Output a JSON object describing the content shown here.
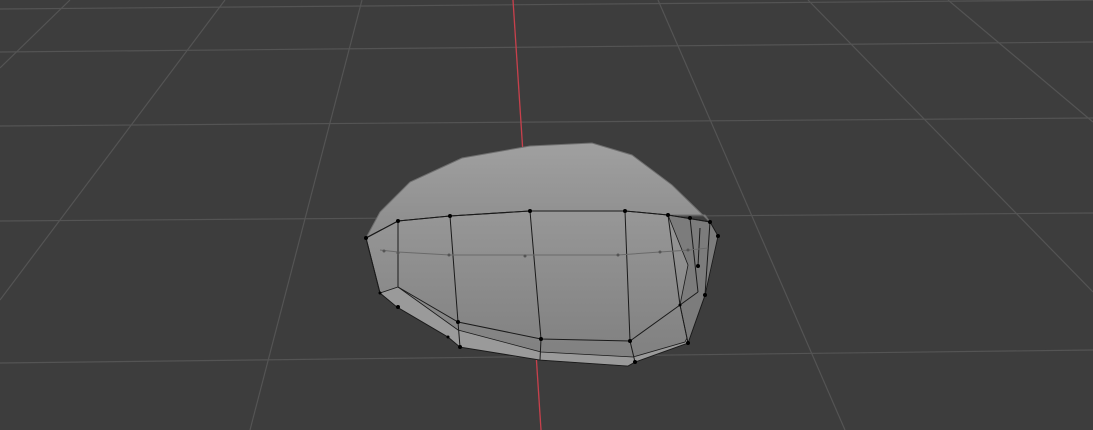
{
  "viewport": {
    "background_color": "#3d3d3d",
    "grid_color": "#545454",
    "x_axis_color": "#c8404c",
    "mesh_fill_color": "#8a8a8a",
    "mesh_edge_color": "#1a1a1a",
    "vertex_color": "#000000",
    "selected_object": "mesh",
    "edit_mode": true
  }
}
